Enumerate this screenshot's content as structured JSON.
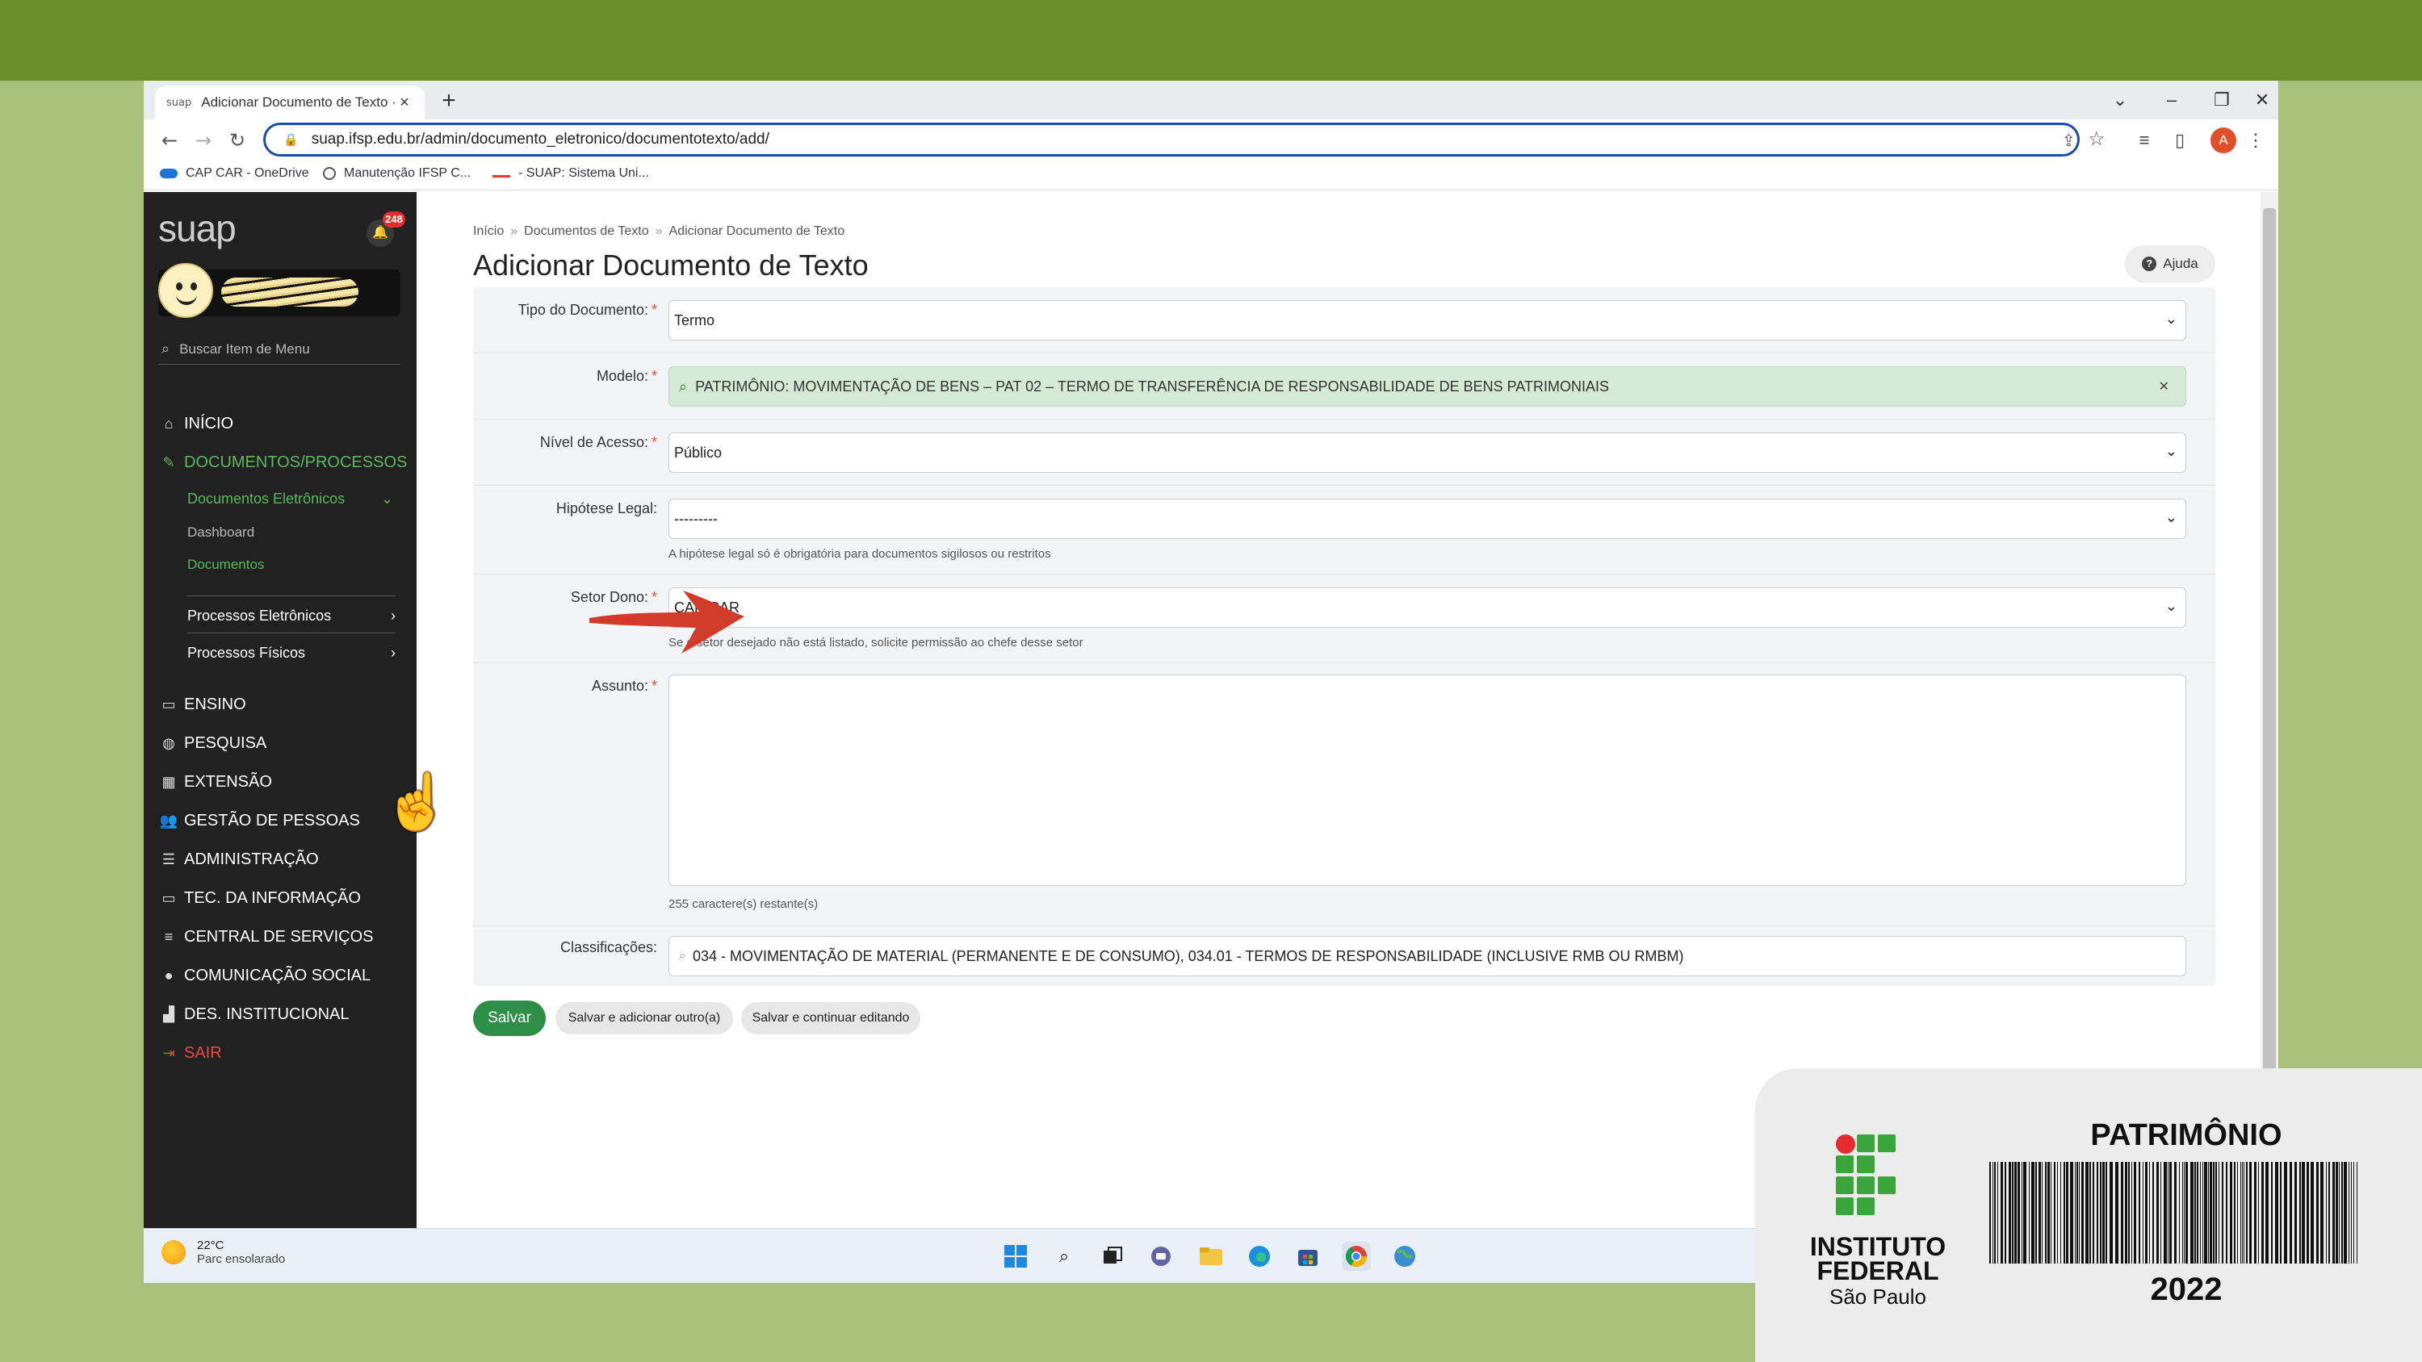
{
  "browser": {
    "tab_title": "Adicionar Documento de Texto ·",
    "tab_favicon": "suap",
    "url": "suap.ifsp.edu.br/admin/documento_eletronico/documentotexto/add/",
    "profile_initial": "A",
    "bookmarks": [
      {
        "label": "CAP CAR - OneDrive"
      },
      {
        "label": "Manutenção IFSP C..."
      },
      {
        "label": "- SUAP: Sistema Uni..."
      }
    ]
  },
  "sidebar": {
    "logo": "suap",
    "notifications": "248",
    "search_placeholder": "Buscar Item de Menu",
    "items": [
      {
        "label": "INÍCIO",
        "icon": "home-icon"
      },
      {
        "label": "DOCUMENTOS/PROCESSOS",
        "icon": "edit-icon"
      },
      {
        "label": "ENSINO",
        "icon": "book-icon"
      },
      {
        "label": "PESQUISA",
        "icon": "globe-icon"
      },
      {
        "label": "EXTENSÃO",
        "icon": "building-icon"
      },
      {
        "label": "GESTÃO DE PESSOAS",
        "icon": "users-icon"
      },
      {
        "label": "ADMINISTRAÇÃO",
        "icon": "list-icon"
      },
      {
        "label": "TEC. DA INFORMAÇÃO",
        "icon": "laptop-icon"
      },
      {
        "label": "CENTRAL DE SERVIÇOS",
        "icon": "bars-icon"
      },
      {
        "label": "COMUNICAÇÃO SOCIAL",
        "icon": "comment-icon"
      },
      {
        "label": "DES. INSTITUCIONAL",
        "icon": "chart-icon"
      },
      {
        "label": "SAIR",
        "icon": "logout-icon"
      }
    ],
    "sub": {
      "documentos_eletronicos": "Documentos Eletrônicos",
      "dashboard": "Dashboard",
      "documentos": "Documentos",
      "processos_eletronicos": "Processos Eletrônicos",
      "processos_fisicos": "Processos Físicos"
    }
  },
  "main": {
    "breadcrumb": [
      "Início",
      "Documentos de Texto",
      "Adicionar Documento de Texto"
    ],
    "title": "Adicionar Documento de Texto",
    "help_label": "Ajuda",
    "form": {
      "tipo": {
        "label": "Tipo do Documento:",
        "value": "Termo"
      },
      "modelo": {
        "label": "Modelo:",
        "value": "PATRIMÔNIO: MOVIMENTAÇÃO DE BENS – PAT 02 – TERMO DE TRANSFERÊNCIA DE RESPONSABILIDADE DE BENS PATRIMONIAIS"
      },
      "nivel": {
        "label": "Nível de Acesso:",
        "value": "Público"
      },
      "hipotese": {
        "label": "Hipótese Legal:",
        "value": "---------",
        "help": "A hipótese legal só é obrigatória para documentos sigilosos ou restritos"
      },
      "setor": {
        "label": "Setor Dono:",
        "value": "CAP-CAR",
        "help": "Se o setor desejado não está listado, solicite permissão ao chefe desse setor"
      },
      "assunto": {
        "label": "Assunto:",
        "value": "",
        "help": "255 caractere(s) restante(s)"
      },
      "classificacoes": {
        "label": "Classificações:",
        "value": "034 - MOVIMENTAÇÃO DE MATERIAL (PERMANENTE E DE CONSUMO), 034.01 - TERMOS DE RESPONSABILIDADE (INCLUSIVE RMB OU RMBM)"
      }
    },
    "buttons": {
      "save": "Salvar",
      "save_add": "Salvar e adicionar outro(a)",
      "save_continue": "Salvar e continuar editando"
    }
  },
  "taskbar": {
    "temperature": "22°C",
    "condition": "Parc ensolarado"
  },
  "card": {
    "institution_line1": "INSTITUTO",
    "institution_line2": "FEDERAL",
    "institution_sub": "São Paulo",
    "title": "PATRIMÔNIO",
    "year": "2022"
  },
  "colors": {
    "accent_green": "#5cb85c",
    "save_green": "#2d8f46",
    "arrow_red": "#d23a2a",
    "background": "#a9c07a",
    "top_band": "#6b8e2b"
  }
}
